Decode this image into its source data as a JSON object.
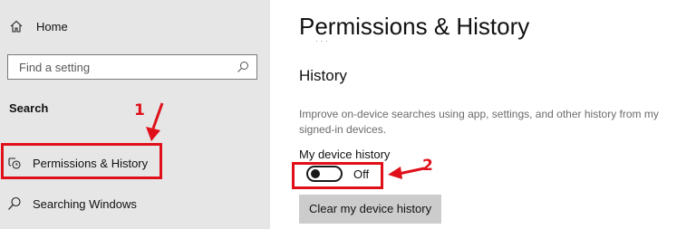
{
  "sidebar": {
    "home_label": "Home",
    "search": {
      "placeholder": "Find a setting"
    },
    "section_title": "Search",
    "items": [
      {
        "label": "Permissions & History",
        "icon": "shield-history-icon"
      },
      {
        "label": "Searching Windows",
        "icon": "search-icon"
      }
    ]
  },
  "main": {
    "title": "Permissions & History",
    "title_clipped": "· · ·",
    "history": {
      "heading": "History",
      "description": "Improve on-device searches using app, settings, and other history from my signed-in devices.",
      "device_history": {
        "label": "My device history",
        "state": "Off"
      },
      "clear_button_label": "Clear my device history"
    }
  },
  "annotations": {
    "callout_1": "1",
    "callout_2": "2",
    "color": "#e0101a"
  }
}
